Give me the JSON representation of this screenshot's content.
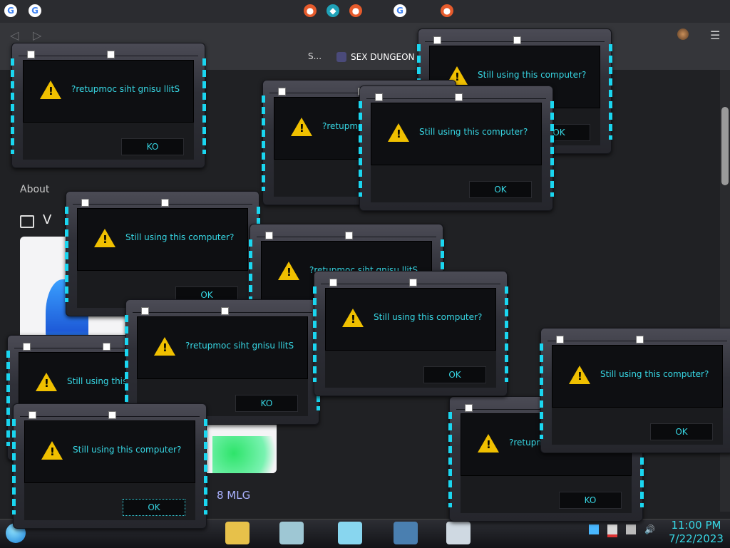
{
  "browser": {
    "tab_partial": "S...",
    "active_tab": "SEX DUNGEON",
    "about_label": "About",
    "v_letter": "V",
    "mlg_text": "8 MLG"
  },
  "dialog_messages": {
    "normal": "Still using this computer?",
    "reversed": "?retupmoc siht gnisu llitS"
  },
  "dialog_buttons": {
    "normal": "OK",
    "reversed": "KO"
  },
  "dialogs": [
    {
      "msg": "?retupmoc siht gnisu llitS",
      "btn": "KO"
    },
    {
      "msg": "Still using this computer?",
      "btn": "OK"
    },
    {
      "msg": "?retupmoc siht gnisu llitS",
      "btn": "KO"
    },
    {
      "msg": "Still using this computer?",
      "btn": "OK"
    },
    {
      "msg": "?retupmoc siht gnisu llitS",
      "btn": "KO"
    },
    {
      "msg": "Still using this computer?",
      "btn": "OK"
    },
    {
      "msg": "?retupmoc siht gnisu llitS",
      "btn": "KO"
    },
    {
      "msg": "Still using this computer?",
      "btn": "OK"
    },
    {
      "msg": "?retupmoc siht gnisu llitS",
      "btn": "KO"
    },
    {
      "msg": "Still using this computer?",
      "btn": "OK"
    },
    {
      "msg": "Still using this computer?",
      "btn": "OK"
    },
    {
      "msg": "Still using this computer?",
      "btn": "OK"
    }
  ],
  "clock": {
    "time": "11:00 PM",
    "date": "7/22/2023"
  },
  "icons": [
    "google-icon",
    "warning-icon",
    "folder-icon",
    "notepad-icon",
    "start-icon"
  ],
  "colors": {
    "accent": "#37d7e4",
    "warning": "#f0c000"
  }
}
